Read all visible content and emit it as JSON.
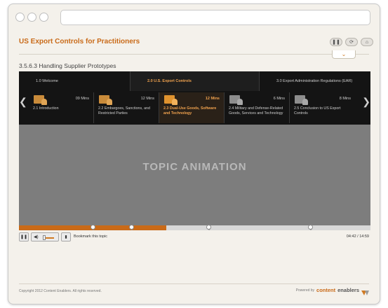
{
  "browser": {
    "window_dots": [
      "close",
      "minimize",
      "maximize"
    ],
    "address_bar_value": ""
  },
  "course": {
    "title": "US Export Controls for Practitioners",
    "header_buttons": [
      {
        "icon": "pause-icon",
        "glyph": "❚❚"
      },
      {
        "icon": "refresh-icon",
        "glyph": "⟳"
      },
      {
        "icon": "home-icon",
        "glyph": "⌂"
      }
    ],
    "collapse_icon": "chevron-down-icon"
  },
  "page": {
    "title": "3.5.6.3 Handling Supplier Prototypes"
  },
  "tabs": [
    {
      "label": "1.0 Welcome",
      "active": false
    },
    {
      "label": "2.0 U.S. Export Controls",
      "active": true
    },
    {
      "label": "3.0 Export Administration Regulations (EAR)",
      "active": false
    }
  ],
  "topics": [
    {
      "label": "2.1 Introduction",
      "mins": "09 Mins",
      "state": "visited"
    },
    {
      "label": "2.2 Embargoes, Sanctions, and Restricted Parties",
      "mins": "12 Mins",
      "state": "visited"
    },
    {
      "label": "2.3 Dual-Use Goods, Software and Technology",
      "mins": "12 Mins",
      "state": "current"
    },
    {
      "label": "2.4 Military and Defense-Related Goods, Services and Technology",
      "mins": "6 Mins",
      "state": "locked"
    },
    {
      "label": "2.5 Conclusion to US Export Controls",
      "mins": "8 Mins",
      "state": "locked"
    }
  ],
  "nav": {
    "prev_glyph": "❮",
    "next_glyph": "❯"
  },
  "stage": {
    "label": "TOPIC ANIMATION"
  },
  "player": {
    "progress_fraction": 0.42,
    "markers_fraction": [
      0.21,
      0.32,
      0.54,
      0.83
    ],
    "pause_glyph": "❚❚",
    "volume_glyph": "◀)",
    "stop_glyph": "▮",
    "bookmark_label": "Bookmark this topic",
    "time": "04:42 / 14:59"
  },
  "footer": {
    "copyright": "Copyright 2012 Content Enablers. All rights reserved.",
    "powered_by": "Powered by",
    "brand_a": "content",
    "brand_b": "enablers"
  },
  "colors": {
    "accent": "#c96a18",
    "dark_nav": "#141414",
    "stage": "#7d7d7d",
    "icon_visited": "#c98b3a",
    "icon_locked": "#8d8d8d"
  }
}
